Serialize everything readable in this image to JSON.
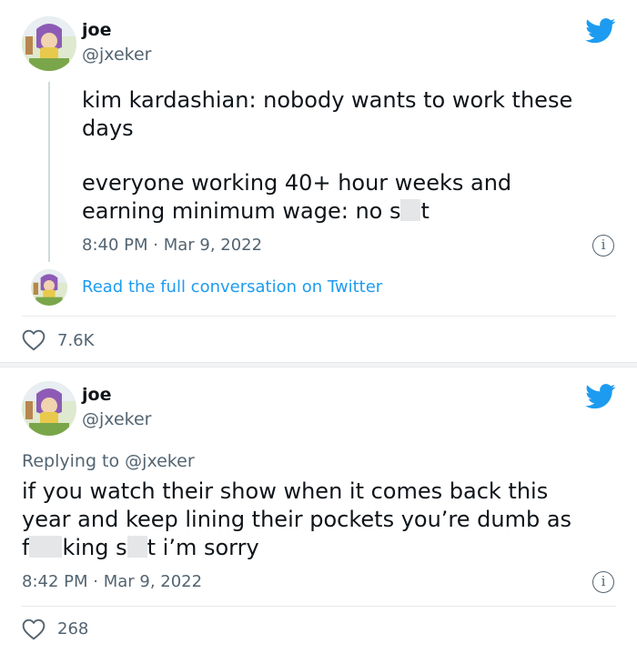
{
  "tweet1": {
    "name": "joe",
    "handle": "@jxeker",
    "line1": "kim kardashian: nobody wants to work these",
    "line2": "days",
    "line3": "everyone working 40+ hour weeks and",
    "line4_pre": "earning minimum wage: no s",
    "line4_post": "t",
    "timestamp": "8:40 PM · Mar 9, 2022",
    "read_more": "Read the full conversation on Twitter",
    "likes": "7.6K"
  },
  "tweet2": {
    "name": "joe",
    "handle": "@jxeker",
    "replying_label": "Replying to",
    "replying_handle": "@jxeker",
    "line1": "if you watch their show when it comes back this",
    "line2": "year and keep lining their pockets you’re dumb as",
    "line3_a": "f",
    "line3_b": "king s",
    "line3_c": "t i’m sorry",
    "timestamp": "8:42 PM · Mar 9, 2022",
    "likes": "268"
  },
  "colors": {
    "twitter_blue": "#1d9bf0",
    "muted_text": "#536471",
    "main_text": "#0f1419"
  },
  "icons": [
    "avatar",
    "twitter-bird-icon",
    "info-icon",
    "heart-icon"
  ]
}
